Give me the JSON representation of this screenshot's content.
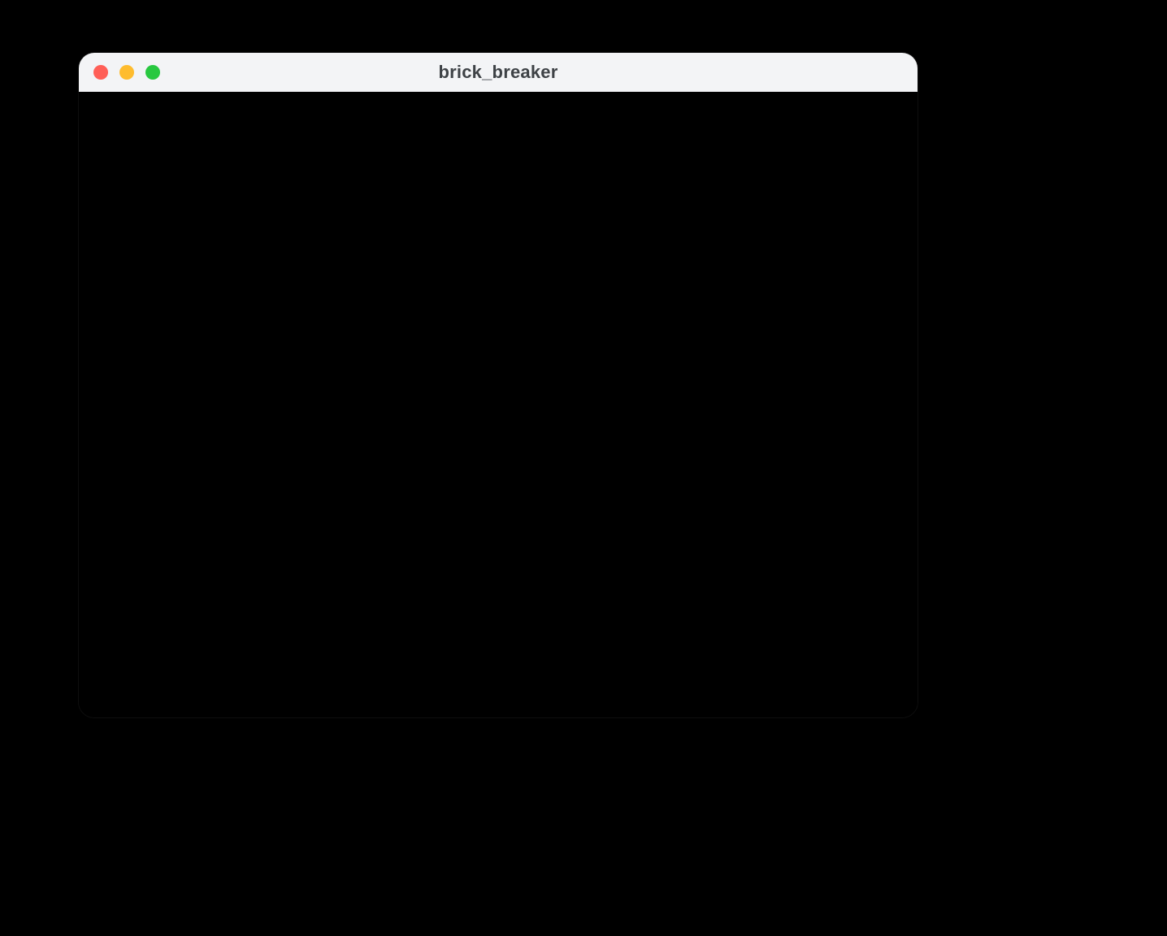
{
  "window": {
    "title": "brick_breaker",
    "traffic_lights": {
      "close": "close",
      "minimize": "minimize",
      "zoom": "zoom"
    }
  }
}
